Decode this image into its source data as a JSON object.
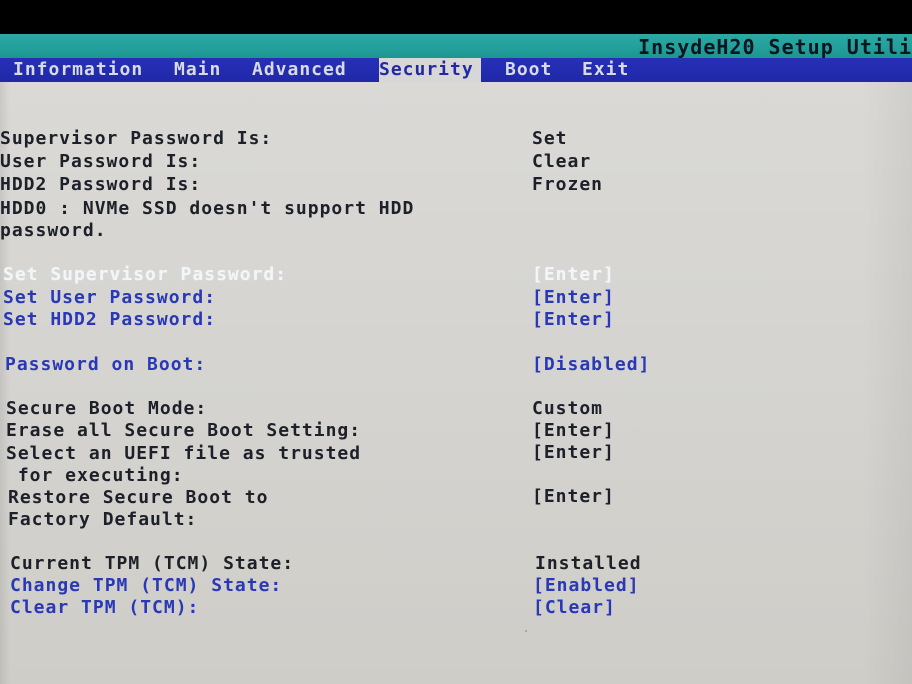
{
  "header": {
    "title": "InsydeH20 Setup Utili"
  },
  "tabs": {
    "information": "Information",
    "main": "Main",
    "advanced": "Advanced",
    "security": "Security",
    "boot": "Boot",
    "exit": "Exit"
  },
  "security": {
    "supervisor_status": {
      "label": "Supervisor Password Is:",
      "value": "Set"
    },
    "user_status": {
      "label": "User Password Is:",
      "value": "Clear"
    },
    "hdd2_status": {
      "label": "HDD2 Password Is:",
      "value": "Frozen"
    },
    "hdd0_note": {
      "label": "HDD0 : NVMe SSD doesn't support HDD\npassword."
    },
    "set_supervisor": {
      "label": "Set Supervisor Password:",
      "value": "[Enter]"
    },
    "set_user": {
      "label": "Set User Password:",
      "value": "[Enter]"
    },
    "set_hdd2": {
      "label": "Set HDD2 Password:",
      "value": "[Enter]"
    },
    "password_on_boot": {
      "label": "Password on Boot:",
      "value": "[Disabled]"
    },
    "secure_boot_mode": {
      "label": "Secure Boot Mode:",
      "value": "Custom"
    },
    "erase_secure_boot": {
      "label": "Erase all Secure Boot Setting:",
      "value": "[Enter]"
    },
    "select_uefi_trusted": {
      "label": "Select an UEFI file as trusted\n for executing:",
      "value": "[Enter]"
    },
    "restore_secure_boot": {
      "label": "Restore Secure Boot to\nFactory Default:",
      "value": "[Enter]"
    },
    "current_tpm_state": {
      "label": "Current TPM (TCM) State:",
      "value": "Installed"
    },
    "change_tpm_state": {
      "label": "Change TPM (TCM) State:",
      "value": "[Enabled]"
    },
    "clear_tpm": {
      "label": "Clear TPM (TCM):",
      "value": "[Clear]"
    }
  },
  "colors": {
    "topbar": "#23a09c",
    "menubar": "#2028a8",
    "content": "#d4d3cf",
    "static_text": "#1d2028",
    "editable_text": "#2938b7",
    "focused_text": "#f2f5fa"
  }
}
